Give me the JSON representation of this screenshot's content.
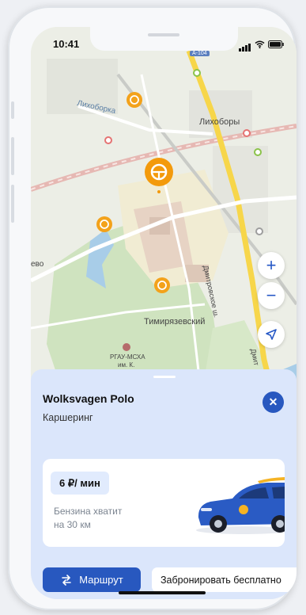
{
  "status": {
    "time": "10:41"
  },
  "map": {
    "labels": {
      "likhoborka": "Лихоборка",
      "likhobory": "Лихоборы",
      "timiryazevsky": "Тимирязевский",
      "dmitrovskoe": "Дмитровское ш.",
      "dmitr2": "Дмит",
      "rgau": "РГАУ-МСХА",
      "rgau2": "им. К.",
      "evo": "ево",
      "road_a104": "А-104"
    },
    "controls": {
      "zoom_in": "+",
      "zoom_out": "−"
    },
    "colors": {
      "marker": "#f3a21b",
      "marker_big": "#f39a0c"
    }
  },
  "sheet": {
    "title": "Wolksvagen Polo",
    "subtitle": "Каршеринг",
    "close_label": "✕",
    "price": "6 ₽/ мин",
    "fuel_line1": "Бензина хватит",
    "fuel_line2": "на 30 км",
    "route_label": "Маршрут",
    "book_label": "Забронировать бесплатно"
  },
  "colors": {
    "accent": "#2858bf",
    "sheet_bg": "#dbe6fb"
  }
}
